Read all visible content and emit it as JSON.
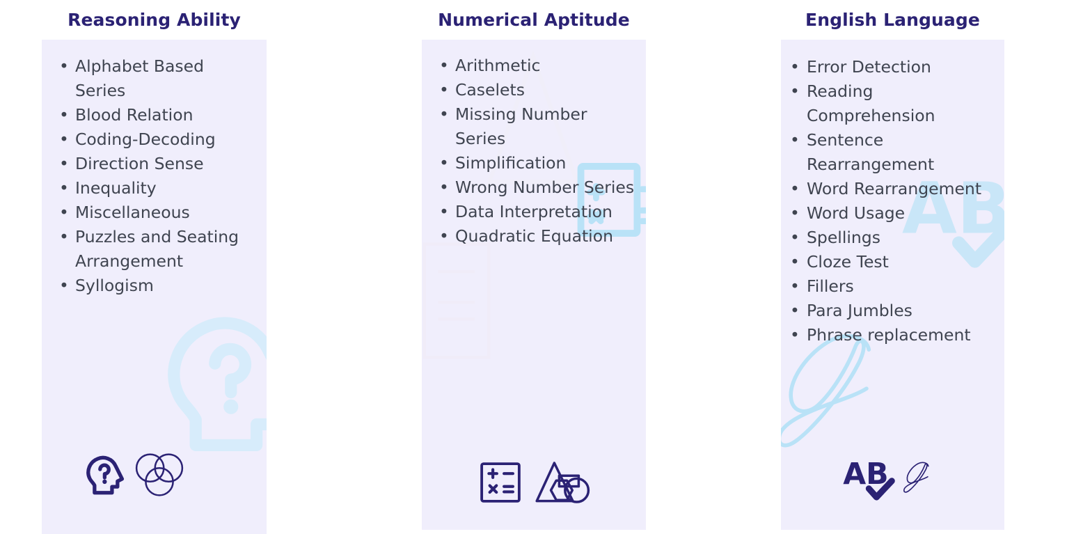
{
  "page": {
    "background_color": "#ffffff",
    "panel_color": "#f0eefc",
    "title_color": "#2b2274",
    "text_color": "#3f4450",
    "icon_color": "#2b2274",
    "watermark_color": "#cfe9fa"
  },
  "columns": [
    {
      "id": "reasoning-ability",
      "title": "Reasoning Ability",
      "topics": [
        "Alphabet Based Series",
        "Blood Relation",
        "Coding-Decoding",
        "Direction Sense",
        "Inequality",
        "Miscellaneous",
        "Puzzles and Seating Arrangement",
        "Syllogism"
      ],
      "watermark_icons": [
        "head-question-mark-icon"
      ],
      "footer_icons": [
        "head-question-mark-icon",
        "venn-diagram-icon"
      ]
    },
    {
      "id": "numerical-aptitude",
      "title": "Numerical Aptitude",
      "topics": [
        "Arithmetic",
        "Caselets",
        "Missing Number Series",
        "Simplification",
        "Wrong Number Series",
        "Data Interpretation",
        "Quadratic Equation"
      ],
      "watermark_icons": [
        "calculator-icon",
        "triangle-icon",
        "paper-sheet-icon"
      ],
      "footer_icons": [
        "calculator-icon",
        "geometric-shapes-icon"
      ]
    },
    {
      "id": "english-language",
      "title": "English Language",
      "topics": [
        "Error Detection",
        "Reading Comprehension",
        "Sentence Rearrangement",
        "Word Rearrangement",
        "Word Usage",
        "Spellings",
        "Cloze Test",
        "Fillers",
        "Para Jumbles",
        "Phrase replacement"
      ],
      "watermark_icons": [
        "ab-check-icon",
        "cursive-g-icon"
      ],
      "footer_icons": [
        "ab-check-icon",
        "cursive-g-icon"
      ]
    }
  ]
}
